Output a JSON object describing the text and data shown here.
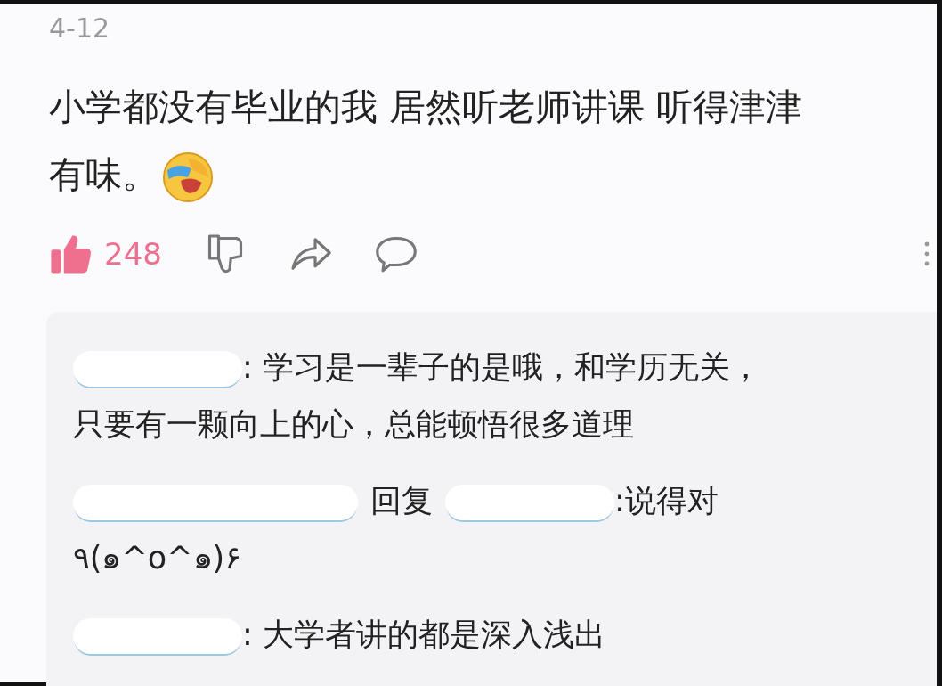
{
  "date": "4-12",
  "post": {
    "lines": [
      "小学都没有毕业的我 居然听老师讲课 听得津津",
      "有味。"
    ]
  },
  "actions": {
    "likes": "248",
    "liked": true
  },
  "replies": [
    {
      "kind": "comment",
      "lines": [
        ": 学习是一辈子的是哦，和学历无关，",
        "只要有一颗向上的心，总能顿悟很多道理"
      ]
    },
    {
      "kind": "reply",
      "verb": "回复",
      "lines": [
        ":说得对",
        "٩(๑^o^๑)۶"
      ]
    },
    {
      "kind": "comment",
      "lines": [
        ": 大学者讲的都是深入浅出"
      ]
    }
  ]
}
